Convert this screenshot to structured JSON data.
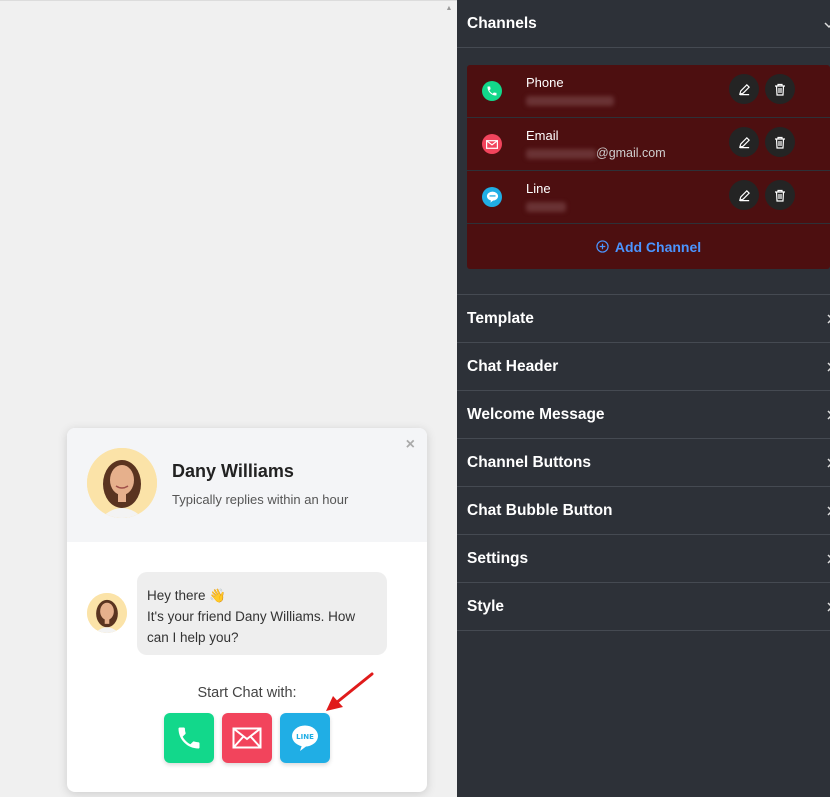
{
  "panel": {
    "channels_title": "Channels",
    "channels": [
      {
        "name": "Phone",
        "value": "",
        "color": "#12d88b",
        "icon": "phone-icon"
      },
      {
        "name": "Email",
        "value": "@gmail.com",
        "color": "#f2445c",
        "icon": "email-icon"
      },
      {
        "name": "Line",
        "value": "",
        "color": "#20aee5",
        "icon": "line-icon"
      }
    ],
    "add_channel": "Add Channel",
    "sections": [
      "Template",
      "Chat Header",
      "Welcome Message",
      "Channel Buttons",
      "Chat Bubble Button",
      "Settings",
      "Style"
    ]
  },
  "widget": {
    "name": "Dany Williams",
    "subtitle": "Typically replies within an hour",
    "close": "×",
    "message_line1": "Hey there 👋",
    "message_line2": "It's your friend Dany Williams. How can I help you?",
    "start_label": "Start Chat with:",
    "line_label": "LINE"
  },
  "colors": {
    "panel_bg": "#2d3138",
    "channels_bg": "#4d0f10",
    "accent_link": "#4b95ff",
    "arrow": "#e01b1b"
  }
}
